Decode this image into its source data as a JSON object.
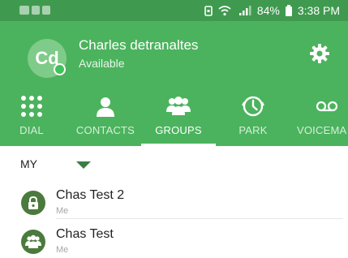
{
  "colors": {
    "header": "#4bb35d",
    "status_bar": "#3f9a4f",
    "accent": "#3a7d44"
  },
  "status_bar": {
    "battery": "84%",
    "time": "3:38 PM"
  },
  "profile": {
    "initials": "Cd",
    "name": "Charles detranaltes",
    "status": "Available"
  },
  "tabs": [
    {
      "label": "DIAL",
      "icon": "dialpad-icon",
      "active": false
    },
    {
      "label": "CONTACTS",
      "icon": "person-icon",
      "active": false
    },
    {
      "label": "GROUPS",
      "icon": "group-icon",
      "active": true
    },
    {
      "label": "PARK",
      "icon": "clock-park-icon",
      "active": false
    },
    {
      "label": "VOICEMA",
      "icon": "voicemail-icon",
      "active": false
    }
  ],
  "section": {
    "title": "MY"
  },
  "groups": [
    {
      "name": "Chas Test 2",
      "owner": "Me",
      "icon": "lock-icon"
    },
    {
      "name": "Chas Test",
      "owner": "Me",
      "icon": "group-icon"
    }
  ]
}
